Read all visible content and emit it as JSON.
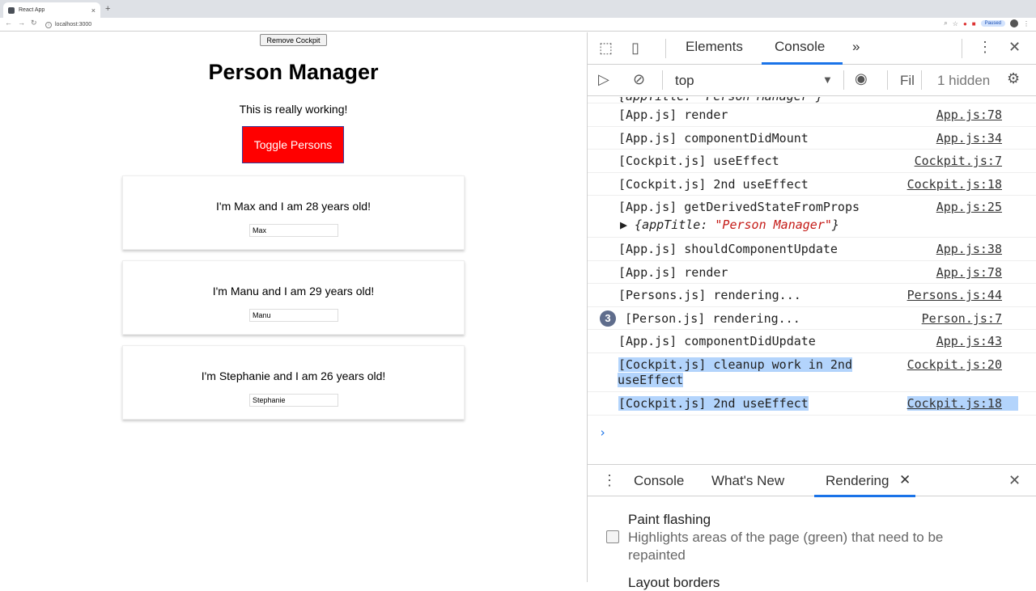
{
  "browser": {
    "tab_title": "React App",
    "tab_close": "×",
    "new_tab": "+",
    "url": "localhost:3000",
    "paused_label": "Paused"
  },
  "page": {
    "remove_cockpit_label": "Remove Cockpit",
    "title": "Person Manager",
    "subtitle": "This is really working!",
    "toggle_label": "Toggle Persons",
    "toggle_color": "#ff0000",
    "persons": [
      {
        "text": "I'm Max and I am 28 years old!",
        "value": "Max"
      },
      {
        "text": "I'm Manu and I am 29 years old!",
        "value": "Manu"
      },
      {
        "text": "I'm Stephanie and I am 26 years old!",
        "value": "Stephanie"
      }
    ]
  },
  "devtools": {
    "tabs": [
      "Elements",
      "Console"
    ],
    "active_tab": "Console",
    "more_tabs": "»",
    "context": "top",
    "filter_placeholder": "Fil",
    "hidden_count": "1 hidden",
    "logs": [
      {
        "msg": "[App.js] render",
        "src": "App.js:78"
      },
      {
        "msg": "[App.js] componentDidMount",
        "src": "App.js:34"
      },
      {
        "msg": "[Cockpit.js] useEffect",
        "src": "Cockpit.js:7"
      },
      {
        "msg": "[Cockpit.js] 2nd useEffect",
        "src": "Cockpit.js:18"
      },
      {
        "msg": "[App.js] getDerivedStateFromProps",
        "src": "App.js:25",
        "obj_key": "appTitle: ",
        "obj_val": "\"Person Manager\""
      },
      {
        "msg": "[App.js] shouldComponentUpdate",
        "src": "App.js:38"
      },
      {
        "msg": "[App.js] render",
        "src": "App.js:78"
      },
      {
        "msg": "[Persons.js] rendering...",
        "src": "Persons.js:44"
      },
      {
        "msg": "[Person.js] rendering...",
        "src": "Person.js:7",
        "count": "3"
      },
      {
        "msg": "[App.js] componentDidUpdate",
        "src": "App.js:43"
      },
      {
        "msg": "[Cockpit.js] cleanup work in 2nd",
        "msg2": "useEffect",
        "src": "Cockpit.js:20"
      },
      {
        "msg": "[Cockpit.js] 2nd useEffect",
        "src": "Cockpit.js:18"
      }
    ],
    "top_partial": "{appTitle: \"Person Manager\"}",
    "prompt": "›",
    "drawer_tabs": [
      "Console",
      "What's New",
      "Rendering"
    ],
    "drawer_active": "Rendering",
    "paint_flashing_title": "Paint flashing",
    "paint_flashing_desc": "Highlights areas of the page (green) that need to be repainted",
    "next_option_title": "Layout borders"
  }
}
